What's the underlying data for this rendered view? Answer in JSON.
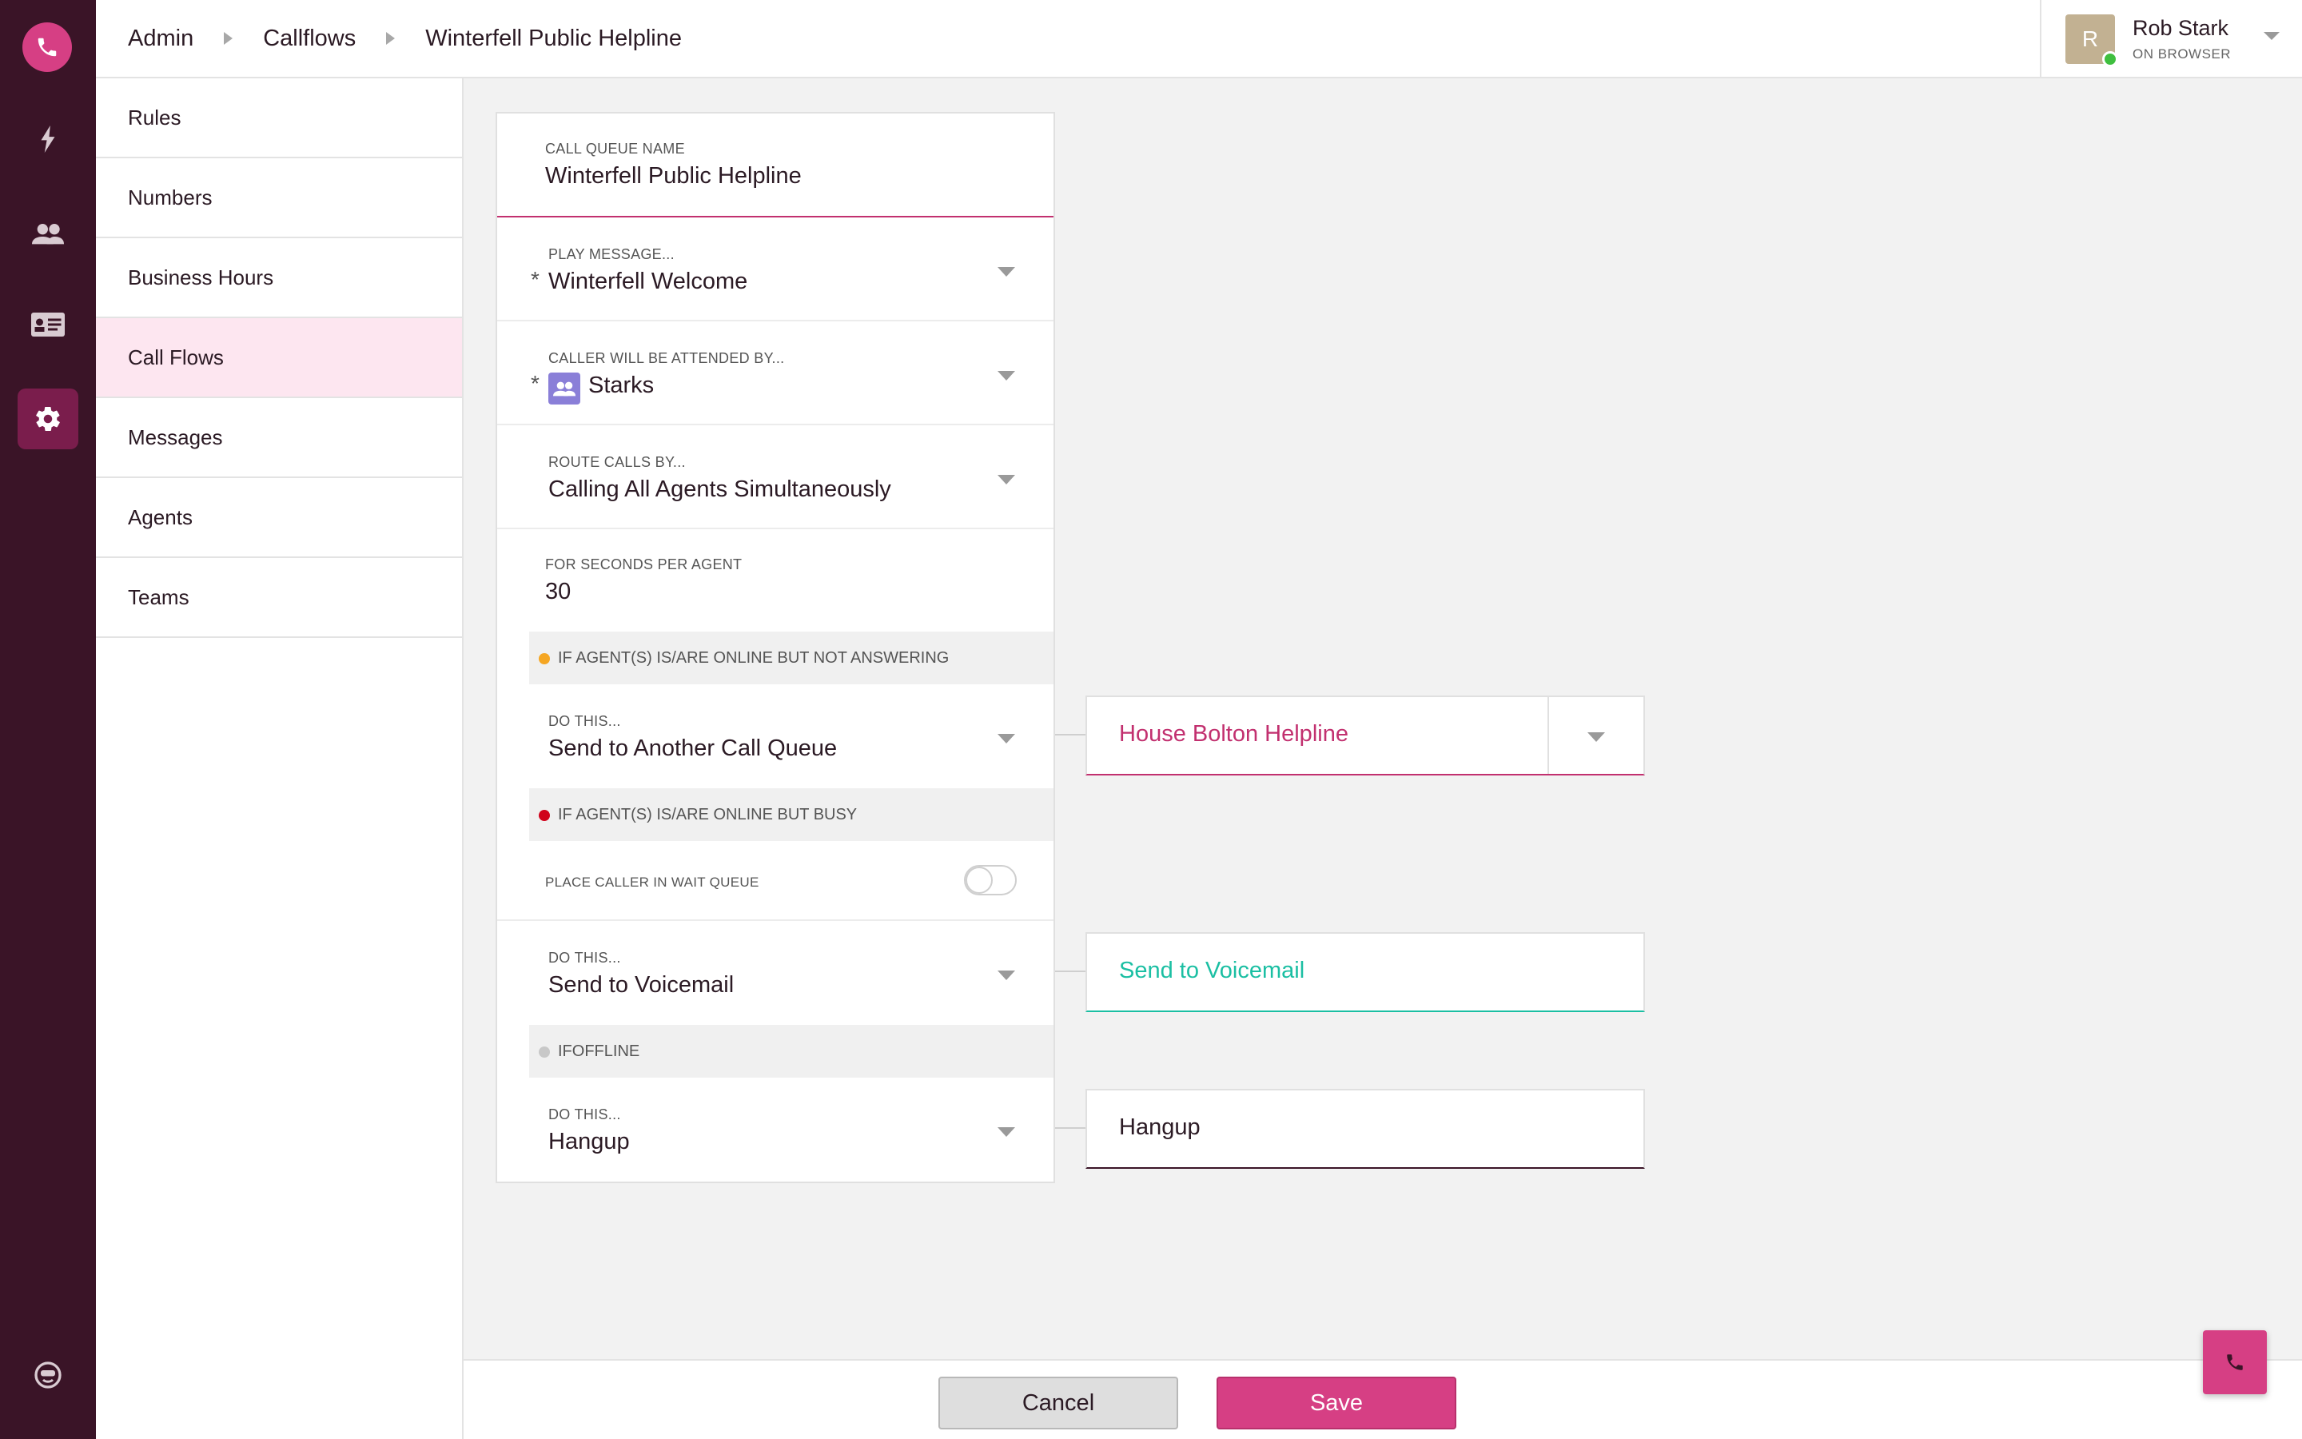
{
  "colors": {
    "rail_bg": "#3a1427",
    "accent": "#d63f84",
    "teal": "#1bbfa3",
    "status_online": "#3fbf3f",
    "band_not_answering": "#f5a623",
    "band_busy": "#d0021b",
    "band_offline": "#c8c8c8"
  },
  "rail": {
    "icons": [
      "phone-logo-icon",
      "bolt-icon",
      "people-icon",
      "id-card-icon",
      "gear-icon",
      "chat-bot-icon"
    ],
    "active": "gear-icon"
  },
  "breadcrumb": [
    "Admin",
    "Callflows",
    "Winterfell Public Helpline"
  ],
  "user": {
    "initial": "R",
    "name": "Rob Stark",
    "status": "ON BROWSER"
  },
  "subnav": {
    "items": [
      "Rules",
      "Numbers",
      "Business Hours",
      "Call Flows",
      "Messages",
      "Agents",
      "Teams"
    ],
    "active": "Call Flows"
  },
  "form": {
    "queue_name": {
      "label": "CALL QUEUE NAME",
      "value": "Winterfell Public Helpline"
    },
    "play_message": {
      "label": "PLAY MESSAGE...",
      "value": "Winterfell Welcome",
      "required": "*"
    },
    "attended_by": {
      "label": "CALLER WILL BE ATTENDED BY...",
      "value": "Starks",
      "required": "*"
    },
    "route_calls": {
      "label": "ROUTE CALLS BY...",
      "value": "Calling All Agents Simultaneously"
    },
    "seconds_per_agent": {
      "label": "FOR SECONDS PER AGENT",
      "value": "30"
    },
    "not_answering": {
      "band": "IF AGENT(S) IS/ARE ONLINE BUT NOT ANSWERING",
      "do_label": "DO THIS...",
      "do_value": "Send to Another Call Queue"
    },
    "busy": {
      "band": "IF AGENT(S) IS/ARE ONLINE BUT BUSY",
      "wait_queue_label": "PLACE CALLER IN WAIT QUEUE",
      "wait_queue_on": false,
      "do_label": "DO THIS...",
      "do_value": "Send to Voicemail"
    },
    "offline": {
      "band": "IFOFFLINE",
      "do_label": "DO THIS...",
      "do_value": "Hangup"
    }
  },
  "outcomes": {
    "not_answering": "House Bolton Helpline",
    "busy": "Send to Voicemail",
    "offline": "Hangup"
  },
  "footer": {
    "cancel_label": "Cancel",
    "save_label": "Save"
  }
}
